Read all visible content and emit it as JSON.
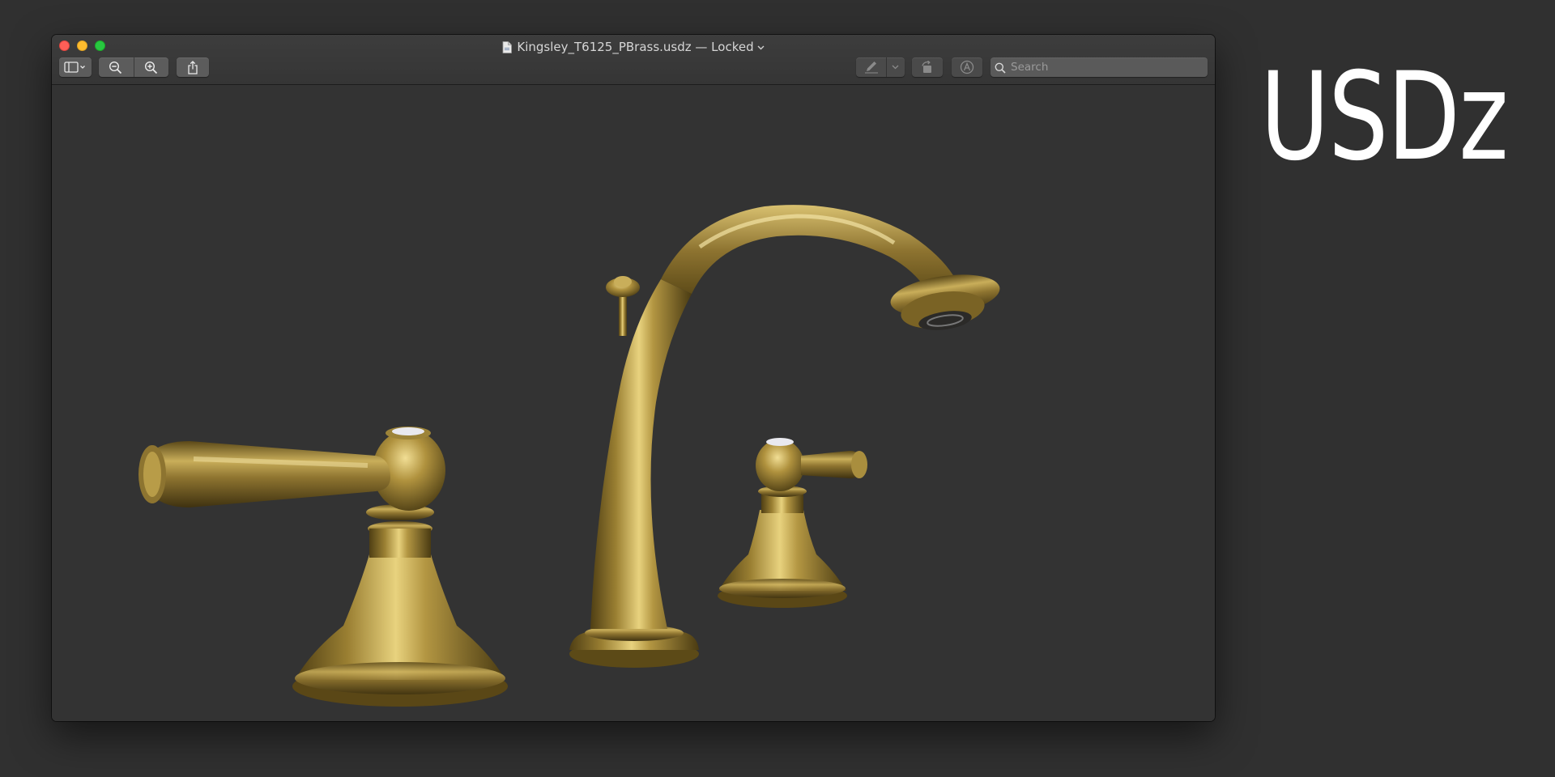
{
  "window": {
    "title": "Kingsley_T6125_PBrass.usdz — Locked",
    "title_menu_icon": "chevron-down-icon",
    "document_icon": "document-icon"
  },
  "toolbar": {
    "sidebar_button_icon": "sidebar-icon",
    "zoom_out_icon": "zoom-out-icon",
    "zoom_in_icon": "zoom-in-icon",
    "share_icon": "share-icon",
    "markup_icon": "pen-icon",
    "rotate_icon": "rotate-icon",
    "annotate_icon": "markup-circle-icon",
    "search": {
      "placeholder": "Search",
      "value": ""
    }
  },
  "viewport": {
    "content": "3D model preview: brass three-piece faucet set",
    "background_color": "#333333",
    "model_color": "#b59a44"
  },
  "brand": {
    "label": "USDz"
  },
  "colors": {
    "page_background": "#303030",
    "window_chrome": "#3a3a3a",
    "close": "#fe5f57",
    "minimize": "#febc2e",
    "maximize": "#28c840"
  }
}
